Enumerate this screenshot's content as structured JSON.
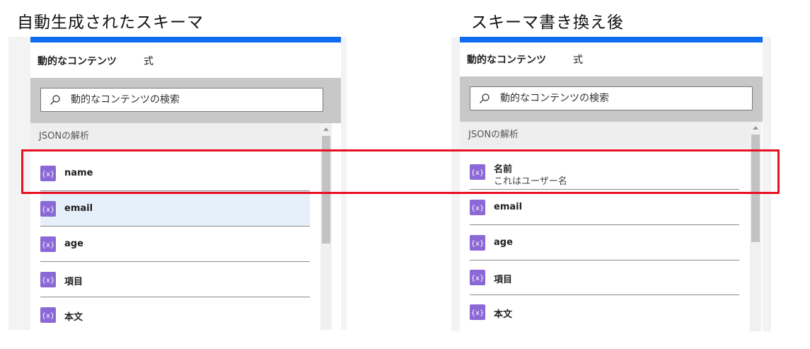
{
  "captions": {
    "left": "自動生成されたスキーマ",
    "right": "スキーマ書き換え後"
  },
  "colors": {
    "accent": "#0f6cf0",
    "badge": "#8a68d6",
    "highlight": "#e81123",
    "hover_row": "#e6f0fb"
  },
  "left_panel": {
    "tabs": [
      {
        "label": "動的なコンテンツ",
        "active": true
      },
      {
        "label": "式",
        "active": false
      }
    ],
    "search": {
      "placeholder": "動的なコンテンツの検索",
      "icon": "search-icon"
    },
    "section_title": "JSONの解析",
    "items": [
      {
        "label": "name",
        "icon": "json-variable-icon"
      },
      {
        "label": "email",
        "icon": "json-variable-icon",
        "hovered": true
      },
      {
        "label": "age",
        "icon": "json-variable-icon"
      },
      {
        "label": "項目",
        "icon": "json-variable-icon"
      },
      {
        "label": "本文",
        "icon": "json-variable-icon"
      }
    ]
  },
  "right_panel": {
    "tabs": [
      {
        "label": "動的なコンテンツ",
        "active": true
      },
      {
        "label": "式",
        "active": false
      }
    ],
    "search": {
      "placeholder": "動的なコンテンツの検索",
      "icon": "search-icon"
    },
    "section_title": "JSONの解析",
    "items": [
      {
        "label": "名前",
        "description": "これはユーザー名",
        "icon": "json-variable-icon"
      },
      {
        "label": "email",
        "icon": "json-variable-icon"
      },
      {
        "label": "age",
        "icon": "json-variable-icon"
      },
      {
        "label": "項目",
        "icon": "json-variable-icon"
      },
      {
        "label": "本文",
        "icon": "json-variable-icon"
      }
    ]
  }
}
